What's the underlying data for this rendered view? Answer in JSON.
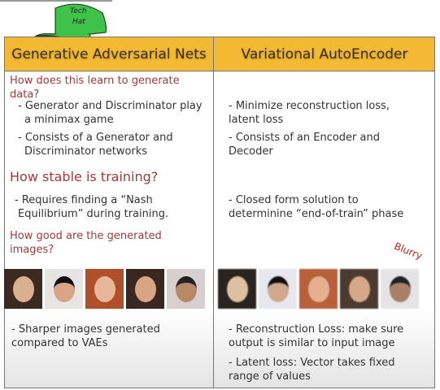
{
  "logo": {
    "text": "Tech Hat"
  },
  "header": {
    "gan": "Generative Adversarial Nets",
    "vae": "Variational AutoEncoder"
  },
  "questions": {
    "q1": [
      "How does this learn to generate",
      "data?"
    ],
    "q2": "How stable is training?",
    "q3": [
      "How good are the generated",
      "images?"
    ]
  },
  "gan": {
    "a1": [
      "- Generator and Discriminator play",
      "a minimax game"
    ],
    "a2": [
      "- Consists of a Generator and",
      "Discriminator networks"
    ],
    "a3": [
      "- Requires finding a “Nash",
      "Equilibrium” during training."
    ],
    "a4": [
      "- Sharper images  generated",
      "compared to VAEs"
    ]
  },
  "vae": {
    "a1": [
      "- Minimize reconstruction loss,",
      "latent loss"
    ],
    "a2": [
      "- Consists of an Encoder and",
      "Decoder"
    ],
    "a3": [
      "- Closed form solution to",
      "determinine “end-of-train” phase"
    ],
    "annotation": "Blurry",
    "a4": [
      "- Reconstruction Loss: make sure",
      "output is similar to input image"
    ],
    "a5": [
      "- Latent loss: Vector takes fixed",
      "range of values"
    ]
  },
  "colors": {
    "header": "#f3b933",
    "question": "#a23a3f",
    "hat": "#3fc24a"
  }
}
